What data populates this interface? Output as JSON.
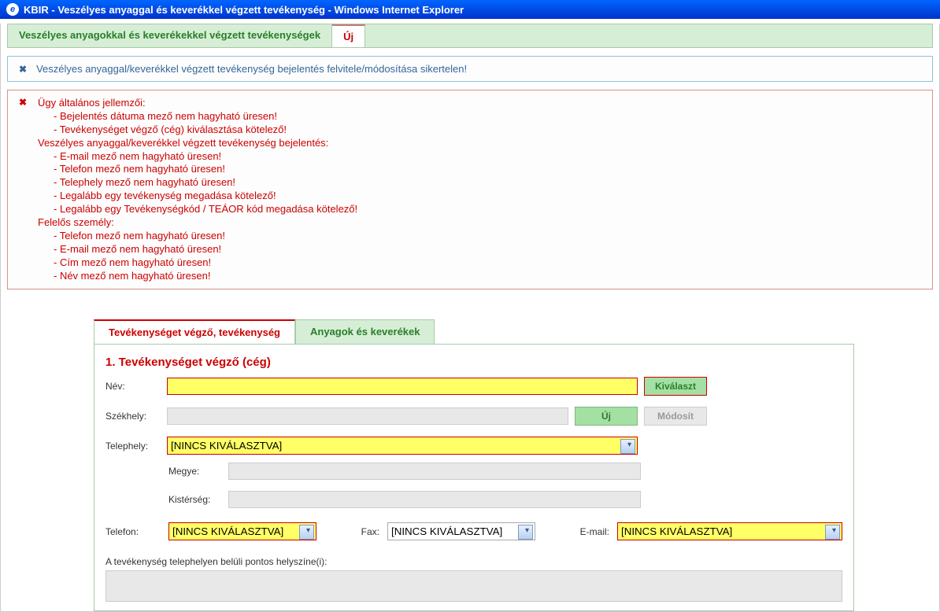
{
  "window": {
    "title": "KBIR - Veszélyes anyaggal és keverékkel végzett tevékenység - Windows Internet Explorer"
  },
  "topTabs": {
    "main": "Veszélyes anyagokkal és keverékekkel végzett tevékenységek",
    "new": "Új"
  },
  "alert": {
    "message": "Veszélyes anyaggal/keverékkel végzett tevékenység bejelentés felvitele/módosítása sikertelen!"
  },
  "errors": {
    "section1": "Ügy általános jellemzői:",
    "s1_items": [
      "- Bejelentés dátuma mező nem hagyható üresen!",
      "- Tevékenységet végző (cég) kiválasztása kötelező!"
    ],
    "section2": "Veszélyes anyaggal/keverékkel végzett tevékenység bejelentés:",
    "s2_items": [
      "- E-mail mező nem hagyható üresen!",
      "- Telefon mező nem hagyható üresen!",
      "- Telephely mező nem hagyható üresen!",
      "- Legalább egy tevékenység megadása kötelező!",
      "- Legalább egy Tevékenységkód / TEÁOR kód megadása kötelező!"
    ],
    "section3": "Felelős személy:",
    "s3_items": [
      "- Telefon mező nem hagyható üresen!",
      "- E-mail mező nem hagyható üresen!",
      "- Cím mező nem hagyható üresen!",
      "- Név mező nem hagyható üresen!"
    ]
  },
  "formTabs": {
    "tab1": "Tevékenységet végző, tevékenység",
    "tab2": "Anyagok és keverékek"
  },
  "form": {
    "sectionTitle": "1. Tevékenységet végző (cég)",
    "labelName": "Név:",
    "labelSeat": "Székhely:",
    "labelSite": "Telephely:",
    "labelCounty": "Megye:",
    "labelRegion": "Kistérség:",
    "labelPhone": "Telefon:",
    "labelFax": "Fax:",
    "labelEmail": "E-mail:",
    "labelLocation": "A tevékenység telephelyen belüli pontos helyszíne(i):",
    "btnSelect": "Kiválaszt",
    "btnNew": "Új",
    "btnModify": "Módosít",
    "siteValue": "[NINCS KIVÁLASZTVA]",
    "phoneValue": "[NINCS KIVÁLASZTVA]",
    "faxValue": "[NINCS KIVÁLASZTVA]",
    "emailValue": "[NINCS KIVÁLASZTVA]"
  }
}
